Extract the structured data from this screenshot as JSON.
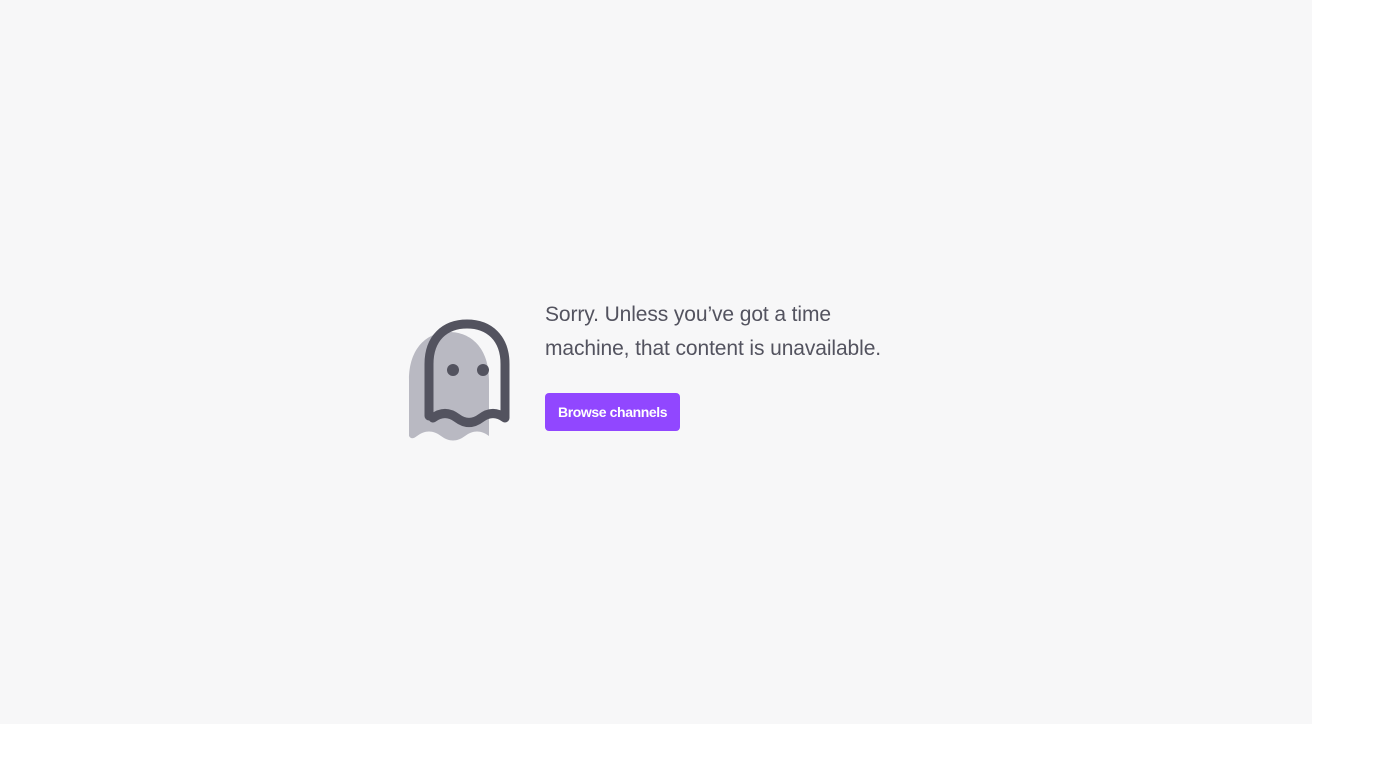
{
  "error_page": {
    "message": "Sorry. Unless you’ve got a time machine, that content is unavailable.",
    "icon": "ghost-icon",
    "browse_button_label": "Browse channels"
  },
  "colors": {
    "page_background": "#f7f7f8",
    "accent": "#9147ff",
    "text": "#53535f",
    "ghost_body": "#b9b9c2",
    "ghost_outline": "#53535f"
  }
}
